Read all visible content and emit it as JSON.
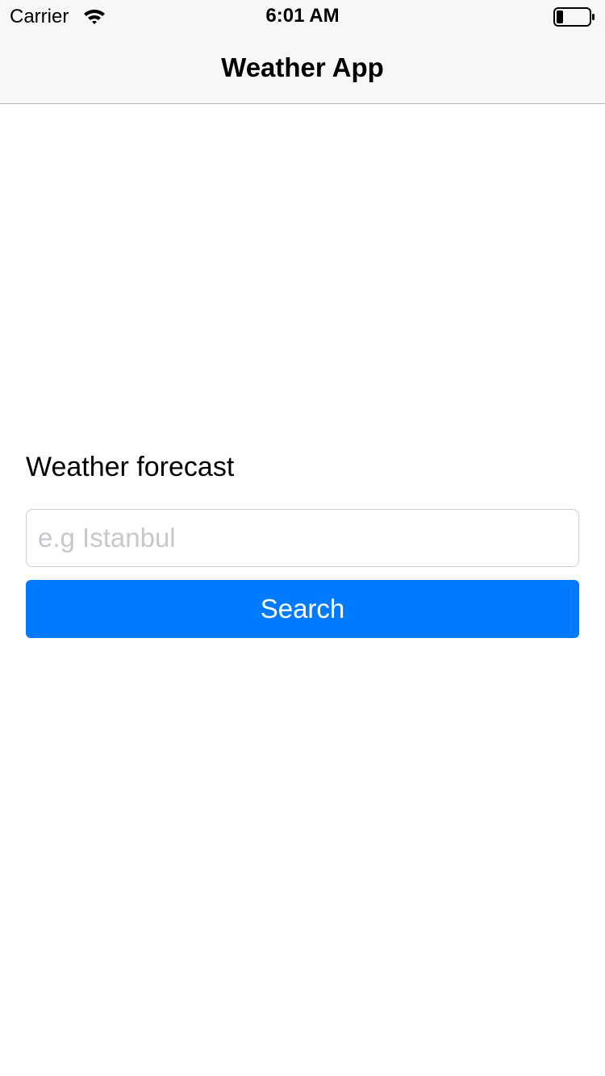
{
  "status_bar": {
    "carrier": "Carrier",
    "time": "6:01 AM",
    "wifi_icon": "wifi-icon",
    "battery_icon": "battery-icon",
    "battery_level": 0.2
  },
  "nav_bar": {
    "title": "Weather App"
  },
  "form": {
    "label": "Weather forecast",
    "city_input_value": "",
    "city_input_placeholder": "e.g Istanbul",
    "search_label": "Search"
  },
  "colors": {
    "accent": "#007aff",
    "bar_background": "#f7f7f7",
    "placeholder": "#c7c7cd"
  }
}
